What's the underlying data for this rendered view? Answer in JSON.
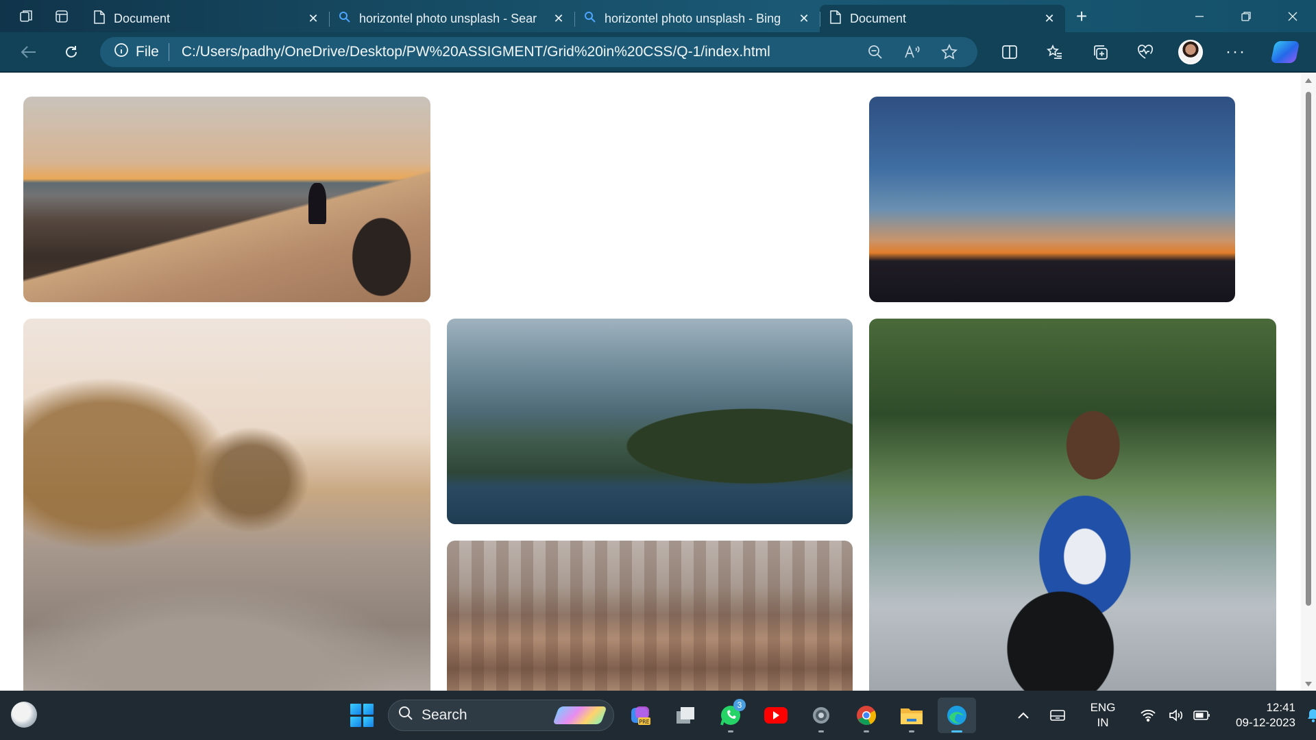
{
  "browser": {
    "tabs": [
      {
        "title": "Document",
        "icon": "page-icon",
        "active": false
      },
      {
        "title": "horizontel photo unsplash - Sear",
        "icon": "search-icon",
        "active": false
      },
      {
        "title": "horizontel photo unsplash - Bing",
        "icon": "search-icon",
        "active": false
      },
      {
        "title": "Document",
        "icon": "page-icon",
        "active": true
      }
    ],
    "address": {
      "scheme_label": "File",
      "url": "C:/Users/padhy/OneDrive/Desktop/PW%20ASSIGMENT/Grid%20in%20CSS/Q-1/index.html"
    }
  },
  "page": {
    "photos": [
      {
        "subject": "desert-sunset"
      },
      {
        "subject": "dusk-horizon"
      },
      {
        "subject": "frosty-field"
      },
      {
        "subject": "misty-lake"
      },
      {
        "subject": "foggy-city"
      },
      {
        "subject": "boy-on-motorbike"
      }
    ]
  },
  "taskbar": {
    "search_label": "Search",
    "whatsapp_badge": "3",
    "language_line1": "ENG",
    "language_line2": "IN",
    "time": "12:41",
    "date": "09-12-2023"
  }
}
